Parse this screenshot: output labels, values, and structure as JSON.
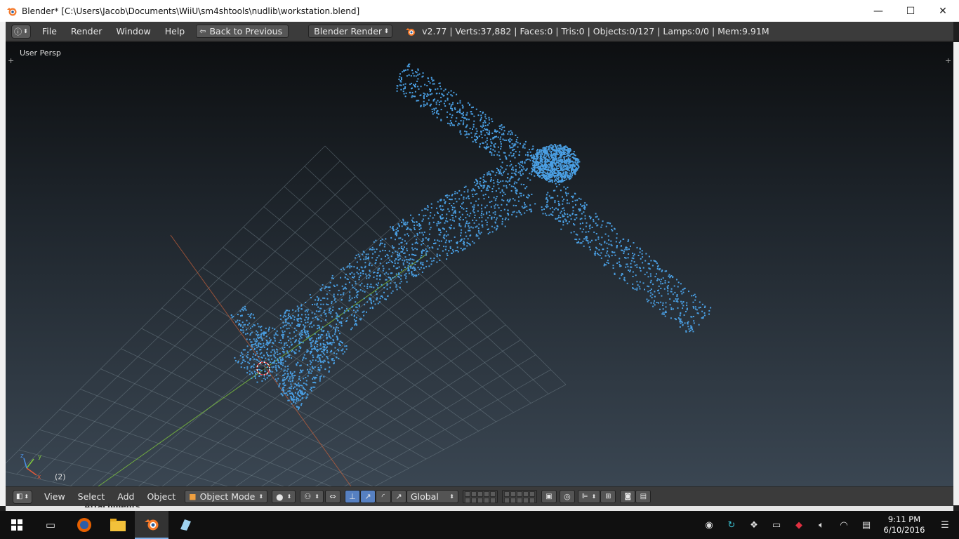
{
  "window": {
    "title": "Blender* [C:\\Users\\Jacob\\Documents\\WiiU\\sm4shtools\\nudlib\\workstation.blend]",
    "minimize": "—",
    "maximize": "☐",
    "close": "✕"
  },
  "menubar": {
    "items": [
      "File",
      "Render",
      "Window",
      "Help"
    ],
    "back_label": "Back to Previous",
    "render_engine": "Blender Render",
    "stats": "v2.77 | Verts:37,882 | Faces:0 | Tris:0 | Objects:0/127 | Lamps:0/0 | Mem:9.91M"
  },
  "viewport": {
    "label": "User Persp",
    "frame": "(2)",
    "point_color": "#4a9fe3",
    "axis_x_color": "#c8613a",
    "axis_y_color": "#7ec43d"
  },
  "bottombar": {
    "menus": [
      "View",
      "Select",
      "Add",
      "Object"
    ],
    "mode": "Object Mode",
    "orientation": "Global"
  },
  "behind_panel_text": "Attachments",
  "taskbar": {
    "time": "9:11 PM",
    "date": "6/10/2016"
  }
}
